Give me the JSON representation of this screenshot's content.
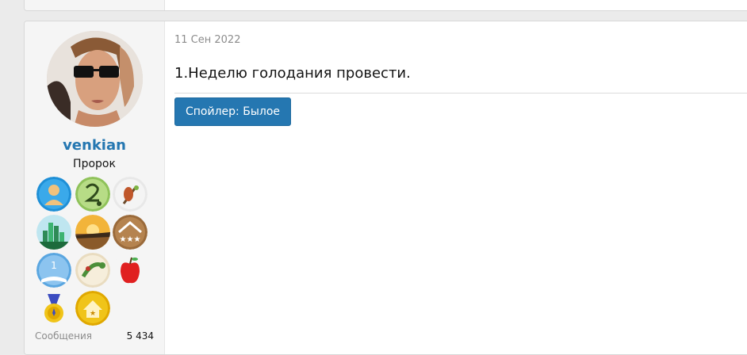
{
  "post": {
    "date": "11 Сен 2022",
    "text": "1.Неделю голодания провести.",
    "spoiler_label": "Спойлер: Былое"
  },
  "user": {
    "name": "venkian",
    "title": "Пророк",
    "avatar_icon": "woman-with-glasses-avatar",
    "trophies": [
      "person-silhouette-trophy-icon",
      "number-two-snake-trophy-icon",
      "bird-on-branch-trophy-icon",
      "green-city-trophy-icon",
      "sunset-field-trophy-icon",
      "stars-roof-trophy-icon",
      "open-book-number-one-trophy-icon",
      "green-lizard-trophy-icon",
      "red-apple-trophy-icon",
      "gold-medal-trophy-icon",
      "gold-house-star-trophy-icon"
    ],
    "stats": {
      "messages_label": "Сообщения",
      "messages_value": "5 434"
    }
  },
  "colors": {
    "accent": "#2577b1",
    "user_bg": "#f5f5f5",
    "page_bg": "#ebebeb"
  }
}
